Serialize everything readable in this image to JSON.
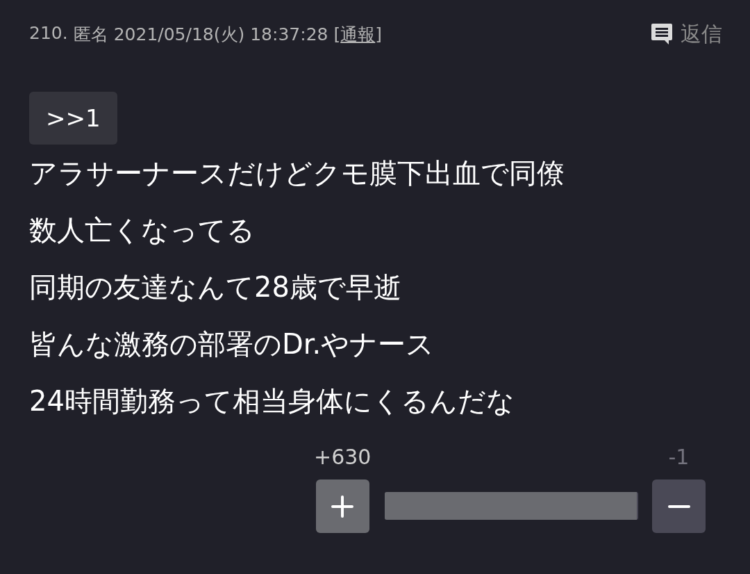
{
  "post": {
    "number": "210.",
    "name": "匿名",
    "datetime": "2021/05/18(火) 18:37:28",
    "report_open": "[",
    "report_link": "通報",
    "report_close": "]",
    "reply_label": "返信"
  },
  "anchor": ">>1",
  "body_lines": [
    "アラサーナースだけどクモ膜下出血で同僚",
    "数人亡くなってる",
    "同期の友達なんて28歳で早逝",
    "皆んな激務の部署のDr.やナース",
    "24時間勤務って相当身体にくるんだな"
  ],
  "votes": {
    "up_count": "+630",
    "down_count": "-1",
    "level": 0.994
  }
}
